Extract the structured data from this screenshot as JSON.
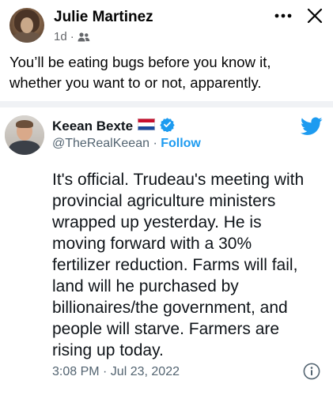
{
  "post": {
    "author": "Julie Martinez",
    "time": "1d",
    "separator": "·",
    "audience_icon": "friends-icon",
    "text": "You’ll be eating bugs before you know it,\nwhether you want to or not, apparently."
  },
  "header_actions": {
    "more_icon": "more-dots-icon",
    "close_icon": "close-icon"
  },
  "tweet": {
    "name": "Keean Bexte",
    "handle": "@TheRealKeean",
    "separator": "·",
    "follow_label": "Follow",
    "flag_icon": "netherlands-flag-icon",
    "verified_icon": "verified-badge-icon",
    "brand_icon": "twitter-bird-icon",
    "body": "It's official. Trudeau's meeting with\nprovincial agriculture ministers\nwrapped up yesterday. He is\nmoving forward with a 30%\nfertilizer reduction. Farms will fail,\nland will he purchased by\nbillionaires/the government, and\npeople will starve. Farmers are\nrising up today.",
    "timestamp": "3:08 PM · Jul 23, 2022",
    "info_icon": "info-icon"
  },
  "colors": {
    "twitter_blue": "#1d9bf0",
    "fb_meta_gray": "#65676b",
    "tweet_gray": "#536471"
  }
}
